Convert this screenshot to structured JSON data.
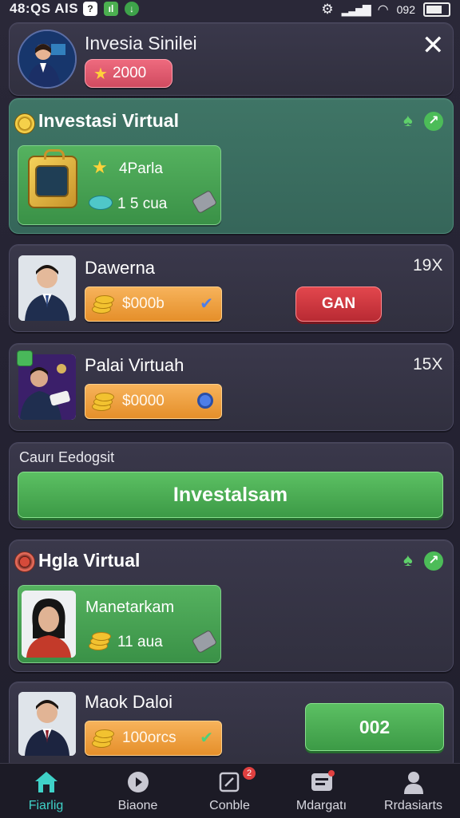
{
  "status_bar": {
    "time": "48:QS AIS",
    "battery": "092"
  },
  "profile": {
    "name": "Invesia Sinilei",
    "points": "2000"
  },
  "featured": {
    "title": "Investasi Virtual",
    "line1": "4Parla",
    "line2": "1 5  cua"
  },
  "items": [
    {
      "name": "Dawerna",
      "multiplier": "19X",
      "amount": "$000b",
      "action": "GAN"
    },
    {
      "name": "Palai Virtuah",
      "multiplier": "15X",
      "amount": "$0000"
    }
  ],
  "deposit": {
    "label": "Caurı Eedogsit",
    "button": "Investalsam"
  },
  "section2": {
    "title": "Hgla Virtual",
    "line1": "Manetarkam",
    "line2": "11  aua"
  },
  "last_item": {
    "name": "Maok Daloi",
    "amount": "100orcs",
    "action": "002"
  },
  "nav": {
    "items": [
      {
        "label": "Fiarlig",
        "icon": "home-icon"
      },
      {
        "label": "Biaone",
        "icon": "play-icon"
      },
      {
        "label": "Conble",
        "icon": "edit-icon",
        "badge": "2"
      },
      {
        "label": "Mdargatı",
        "icon": "list-icon"
      },
      {
        "label": "Rrdasiarts",
        "icon": "user-icon"
      }
    ]
  },
  "colors": {
    "accent_green": "#4caf50",
    "accent_orange": "#f2a03d",
    "accent_red": "#d83a42",
    "points_pill": "#e0566b"
  }
}
